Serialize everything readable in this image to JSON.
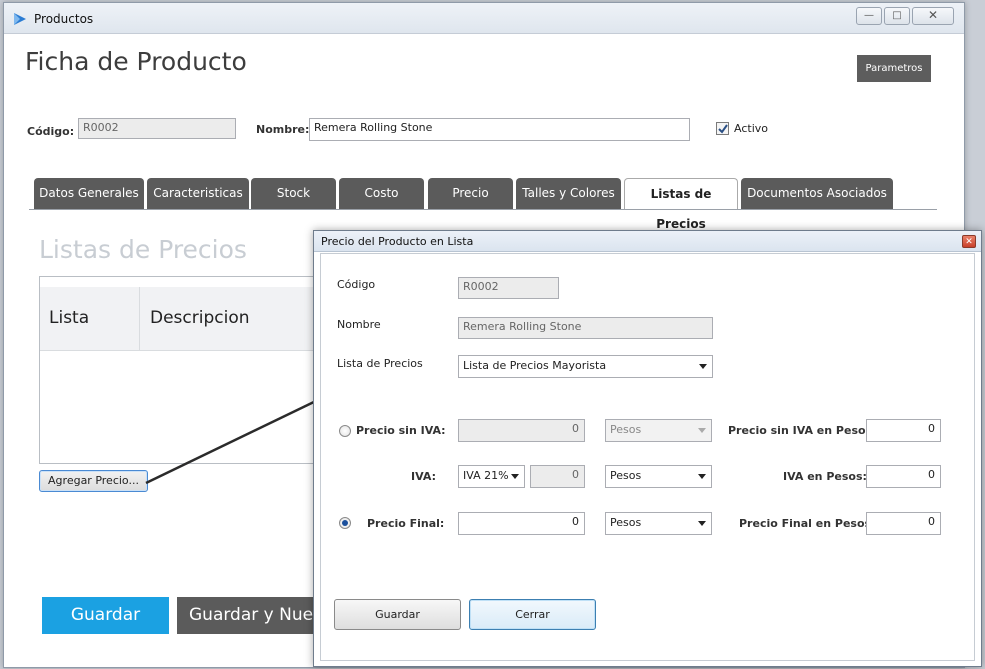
{
  "main_window": {
    "title": "Productos",
    "page_title": "Ficha de Producto",
    "parametros_label": "Parametros",
    "codigo_label": "Código:",
    "codigo_value": "R0002",
    "nombre_label": "Nombre:",
    "nombre_value": "Remera Rolling Stone",
    "activo_label": "Activo",
    "activo_checked": true,
    "tabs": [
      {
        "label": "Datos Generales",
        "active": false
      },
      {
        "label": "Caracteristicas",
        "active": false
      },
      {
        "label": "Stock",
        "active": false
      },
      {
        "label": "Costo",
        "active": false
      },
      {
        "label": "Precio",
        "active": false
      },
      {
        "label": "Talles y Colores",
        "active": false
      },
      {
        "label": "Listas de Precios",
        "active": true
      },
      {
        "label": "Documentos Asociados",
        "active": false
      }
    ],
    "section_title": "Listas de Precios",
    "grid_columns": [
      "Lista",
      "Descripcion"
    ],
    "agregar_precio_label": "Agregar Precio...",
    "guardar_label": "Guardar",
    "guardar_nuevo_label": "Guardar y Nue",
    "accent_color": "#1ba1e2",
    "tab_color": "#5b5b5b"
  },
  "dialog": {
    "title": "Precio del Producto en Lista",
    "codigo_label": "Código",
    "codigo_value": "R0002",
    "nombre_label": "Nombre",
    "nombre_value": "Remera Rolling Stone",
    "lista_label": "Lista de Precios",
    "lista_value": "Lista de Precios Mayorista",
    "precio_sin_iva_label": "Precio sin IVA:",
    "precio_sin_iva_value": "0",
    "precio_sin_iva_currency": "Pesos",
    "precio_sin_iva_pesos_label": "Precio sin IVA en Pesos:",
    "precio_sin_iva_pesos_value": "0",
    "iva_label": "IVA:",
    "iva_rate": "IVA 21%",
    "iva_value": "0",
    "iva_currency": "Pesos",
    "iva_pesos_label": "IVA en Pesos:",
    "iva_pesos_value": "0",
    "precio_final_label": "Precio Final:",
    "precio_final_value": "0",
    "precio_final_currency": "Pesos",
    "precio_final_pesos_label": "Precio Final en Pesos:",
    "precio_final_pesos_value": "0",
    "selected_mode": "precio_final",
    "guardar_label": "Guardar",
    "cerrar_label": "Cerrar"
  }
}
